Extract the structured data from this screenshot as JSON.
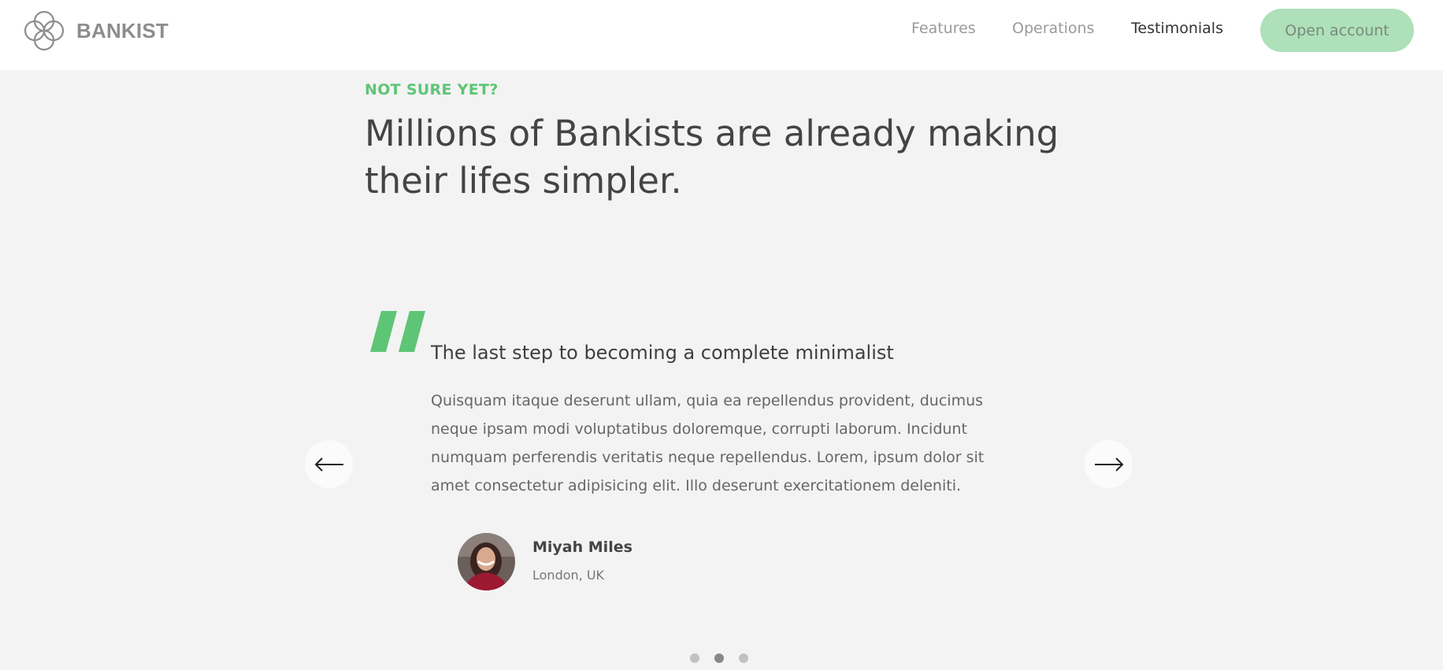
{
  "brand": {
    "name": "BANKIST",
    "logo_icon": "four-circles-logo-icon"
  },
  "nav": {
    "links": [
      {
        "label": "Features",
        "active": false
      },
      {
        "label": "Operations",
        "active": false
      },
      {
        "label": "Testimonials",
        "active": true
      }
    ],
    "cta_label": "Open account"
  },
  "section": {
    "kicker": "NOT SURE YET?",
    "headline": "Millions of Bankists are already making their lifes simpler."
  },
  "testimonial": {
    "quote_icon": "quote-mark-icon",
    "title": "The last step to becoming a complete minimalist",
    "body": "Quisquam itaque deserunt ullam, quia ea repellendus provident, ducimus neque ipsam modi voluptatibus doloremque, corrupti laborum. Incidunt numquam perferendis veritatis neque repellendus. Lorem, ipsum dolor sit amet consectetur adipisicing elit. Illo deserunt exercitationem deleniti.",
    "author": {
      "name": "Miyah Miles",
      "location": "London, UK"
    }
  },
  "slider": {
    "prev_icon": "arrow-left-icon",
    "next_icon": "arrow-right-icon",
    "dots": [
      {
        "active": false
      },
      {
        "active": true
      },
      {
        "active": false
      }
    ]
  },
  "colors": {
    "accent": "#5ec576",
    "cta_bg": "#aee0b9",
    "page_bg": "#f3f3f3",
    "nav_bg": "#ffffff",
    "text_dark": "#444444"
  }
}
